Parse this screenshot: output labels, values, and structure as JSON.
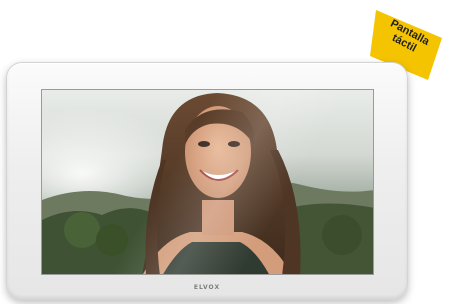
{
  "badge": {
    "line1": "Pantalla",
    "line2": "táctil",
    "color": "#f5c400"
  },
  "device": {
    "brand": "ELVOX",
    "frame_color": "#f1f1f1"
  },
  "screen": {
    "content": "portrait-photo-smiling-woman"
  }
}
